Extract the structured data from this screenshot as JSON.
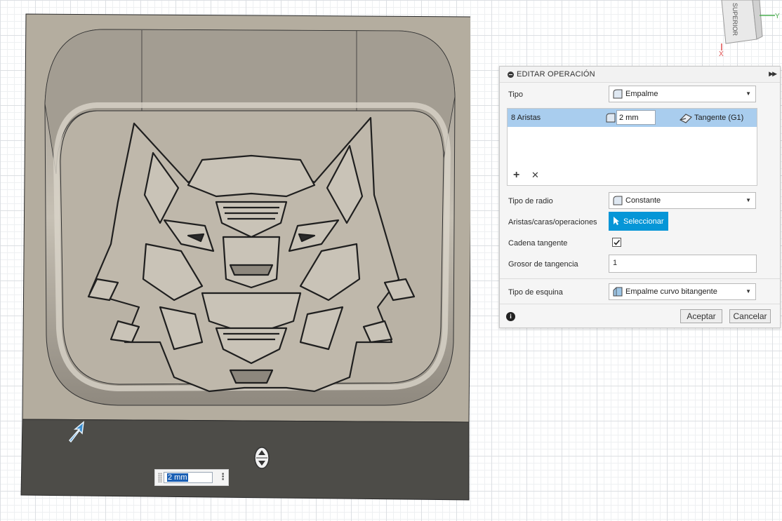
{
  "panel": {
    "title": "EDITAR OPERACIÓN",
    "tipo_label": "Tipo",
    "tipo_value": "Empalme",
    "edges": {
      "name": "8 Aristas",
      "radius": "2 mm",
      "continuity": "Tangente (G1)"
    },
    "tipo_radio_label": "Tipo de radio",
    "tipo_radio_value": "Constante",
    "aristas_label": "Aristas/caras/operaciones",
    "select_label": "Seleccionar",
    "cadena_label": "Cadena tangente",
    "cadena_checked": true,
    "grosor_label": "Grosor de tangencia",
    "grosor_value": "1",
    "esquina_label": "Tipo de esquina",
    "esquina_value": "Empalme curvo bitangente",
    "ok_label": "Aceptar",
    "cancel_label": "Cancelar"
  },
  "viewport": {
    "dimension_value": "2 mm"
  },
  "viewcube": {
    "face_label": "SUPERIOR",
    "axis_x": "X",
    "axis_y": "Y"
  },
  "colors": {
    "accent": "#0696d7",
    "selection": "#a9cdee",
    "model_face": "#b9b2a5",
    "model_side": "#4b4a46"
  }
}
